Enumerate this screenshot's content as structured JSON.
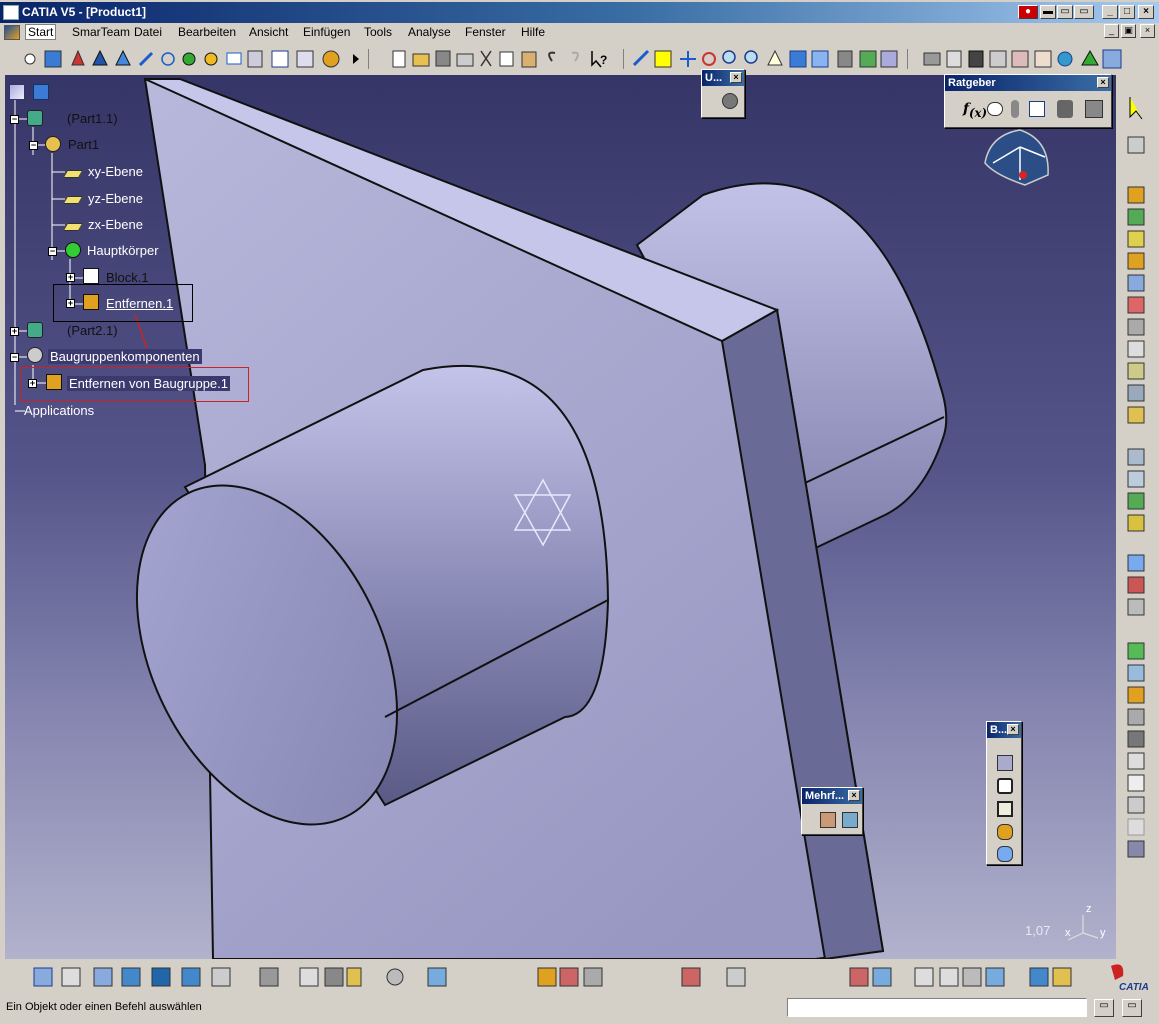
{
  "window": {
    "title": "CATIA V5 - [Product1]"
  },
  "menu": {
    "items": [
      "Start",
      "SmarTeam",
      "Datei",
      "Bearbeiten",
      "Ansicht",
      "Einfügen",
      "Tools",
      "Analyse",
      "Fenster",
      "Hilfe"
    ],
    "active_item": "Start"
  },
  "tree": {
    "nodes": [
      {
        "label": "(Part1.1)",
        "icon": "part-instance-icon"
      },
      {
        "label": "Part1",
        "icon": "part-icon"
      },
      {
        "label": "xy-Ebene",
        "icon": "plane-icon"
      },
      {
        "label": "yz-Ebene",
        "icon": "plane-icon"
      },
      {
        "label": "zx-Ebene",
        "icon": "plane-icon"
      },
      {
        "label": "Hauptkörper",
        "icon": "body-icon"
      },
      {
        "label": "Block.1",
        "icon": "pad-icon"
      },
      {
        "label": "Entfernen.1",
        "icon": "remove-icon"
      },
      {
        "label": "(Part2.1)",
        "icon": "part-instance-icon"
      },
      {
        "label": "Baugruppenkomponenten",
        "icon": "assembly-features-icon"
      },
      {
        "label": "Entfernen von Baugruppe.1",
        "icon": "assembly-remove-icon"
      },
      {
        "label": "Applications",
        "icon": "applications-icon"
      }
    ]
  },
  "floating_toolbars": {
    "u": {
      "title": "U..."
    },
    "ratgeber": {
      "title": "Ratgeber"
    },
    "b": {
      "title": "B..."
    },
    "mehrf": {
      "title": "Mehrf..."
    }
  },
  "viewport": {
    "zoom_readout": "1,07",
    "compass_axis_x": "x",
    "compass_axis_y": "y",
    "compass_axis_z": "z"
  },
  "statusbar": {
    "message": "Ein Objekt oder einen Befehl auswählen",
    "command_input": ""
  },
  "brand": {
    "logo_text": "CATIA"
  },
  "colors": {
    "titlebar_start": "#0a246a",
    "viewport_top": "#353567",
    "viewport_bottom": "#b2b2cd",
    "selection_red": "#cc2222"
  }
}
